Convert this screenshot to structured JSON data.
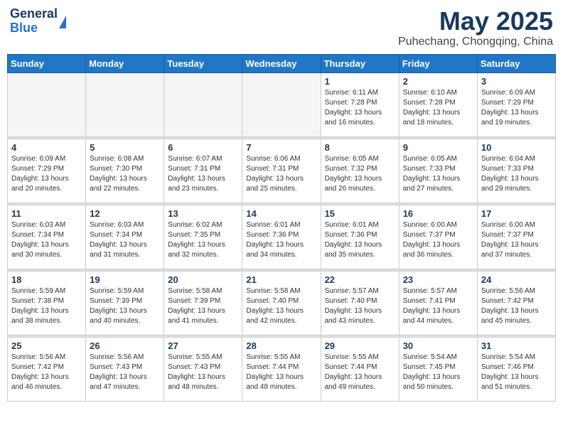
{
  "header": {
    "logo_general": "General",
    "logo_blue": "Blue",
    "month_title": "May 2025",
    "location": "Puhechang, Chongqing, China"
  },
  "weekdays": [
    "Sunday",
    "Monday",
    "Tuesday",
    "Wednesday",
    "Thursday",
    "Friday",
    "Saturday"
  ],
  "weeks": [
    [
      {
        "day": "",
        "info": ""
      },
      {
        "day": "",
        "info": ""
      },
      {
        "day": "",
        "info": ""
      },
      {
        "day": "",
        "info": ""
      },
      {
        "day": "1",
        "info": "Sunrise: 6:11 AM\nSunset: 7:28 PM\nDaylight: 13 hours\nand 16 minutes."
      },
      {
        "day": "2",
        "info": "Sunrise: 6:10 AM\nSunset: 7:28 PM\nDaylight: 13 hours\nand 18 minutes."
      },
      {
        "day": "3",
        "info": "Sunrise: 6:09 AM\nSunset: 7:29 PM\nDaylight: 13 hours\nand 19 minutes."
      }
    ],
    [
      {
        "day": "4",
        "info": "Sunrise: 6:09 AM\nSunset: 7:29 PM\nDaylight: 13 hours\nand 20 minutes."
      },
      {
        "day": "5",
        "info": "Sunrise: 6:08 AM\nSunset: 7:30 PM\nDaylight: 13 hours\nand 22 minutes."
      },
      {
        "day": "6",
        "info": "Sunrise: 6:07 AM\nSunset: 7:31 PM\nDaylight: 13 hours\nand 23 minutes."
      },
      {
        "day": "7",
        "info": "Sunrise: 6:06 AM\nSunset: 7:31 PM\nDaylight: 13 hours\nand 25 minutes."
      },
      {
        "day": "8",
        "info": "Sunrise: 6:05 AM\nSunset: 7:32 PM\nDaylight: 13 hours\nand 26 minutes."
      },
      {
        "day": "9",
        "info": "Sunrise: 6:05 AM\nSunset: 7:33 PM\nDaylight: 13 hours\nand 27 minutes."
      },
      {
        "day": "10",
        "info": "Sunrise: 6:04 AM\nSunset: 7:33 PM\nDaylight: 13 hours\nand 29 minutes."
      }
    ],
    [
      {
        "day": "11",
        "info": "Sunrise: 6:03 AM\nSunset: 7:34 PM\nDaylight: 13 hours\nand 30 minutes."
      },
      {
        "day": "12",
        "info": "Sunrise: 6:03 AM\nSunset: 7:34 PM\nDaylight: 13 hours\nand 31 minutes."
      },
      {
        "day": "13",
        "info": "Sunrise: 6:02 AM\nSunset: 7:35 PM\nDaylight: 13 hours\nand 32 minutes."
      },
      {
        "day": "14",
        "info": "Sunrise: 6:01 AM\nSunset: 7:36 PM\nDaylight: 13 hours\nand 34 minutes."
      },
      {
        "day": "15",
        "info": "Sunrise: 6:01 AM\nSunset: 7:36 PM\nDaylight: 13 hours\nand 35 minutes."
      },
      {
        "day": "16",
        "info": "Sunrise: 6:00 AM\nSunset: 7:37 PM\nDaylight: 13 hours\nand 36 minutes."
      },
      {
        "day": "17",
        "info": "Sunrise: 6:00 AM\nSunset: 7:37 PM\nDaylight: 13 hours\nand 37 minutes."
      }
    ],
    [
      {
        "day": "18",
        "info": "Sunrise: 5:59 AM\nSunset: 7:38 PM\nDaylight: 13 hours\nand 38 minutes."
      },
      {
        "day": "19",
        "info": "Sunrise: 5:59 AM\nSunset: 7:39 PM\nDaylight: 13 hours\nand 40 minutes."
      },
      {
        "day": "20",
        "info": "Sunrise: 5:58 AM\nSunset: 7:39 PM\nDaylight: 13 hours\nand 41 minutes."
      },
      {
        "day": "21",
        "info": "Sunrise: 5:58 AM\nSunset: 7:40 PM\nDaylight: 13 hours\nand 42 minutes."
      },
      {
        "day": "22",
        "info": "Sunrise: 5:57 AM\nSunset: 7:40 PM\nDaylight: 13 hours\nand 43 minutes."
      },
      {
        "day": "23",
        "info": "Sunrise: 5:57 AM\nSunset: 7:41 PM\nDaylight: 13 hours\nand 44 minutes."
      },
      {
        "day": "24",
        "info": "Sunrise: 5:56 AM\nSunset: 7:42 PM\nDaylight: 13 hours\nand 45 minutes."
      }
    ],
    [
      {
        "day": "25",
        "info": "Sunrise: 5:56 AM\nSunset: 7:42 PM\nDaylight: 13 hours\nand 46 minutes."
      },
      {
        "day": "26",
        "info": "Sunrise: 5:56 AM\nSunset: 7:43 PM\nDaylight: 13 hours\nand 47 minutes."
      },
      {
        "day": "27",
        "info": "Sunrise: 5:55 AM\nSunset: 7:43 PM\nDaylight: 13 hours\nand 48 minutes."
      },
      {
        "day": "28",
        "info": "Sunrise: 5:55 AM\nSunset: 7:44 PM\nDaylight: 13 hours\nand 48 minutes."
      },
      {
        "day": "29",
        "info": "Sunrise: 5:55 AM\nSunset: 7:44 PM\nDaylight: 13 hours\nand 49 minutes."
      },
      {
        "day": "30",
        "info": "Sunrise: 5:54 AM\nSunset: 7:45 PM\nDaylight: 13 hours\nand 50 minutes."
      },
      {
        "day": "31",
        "info": "Sunrise: 5:54 AM\nSunset: 7:46 PM\nDaylight: 13 hours\nand 51 minutes."
      }
    ]
  ]
}
